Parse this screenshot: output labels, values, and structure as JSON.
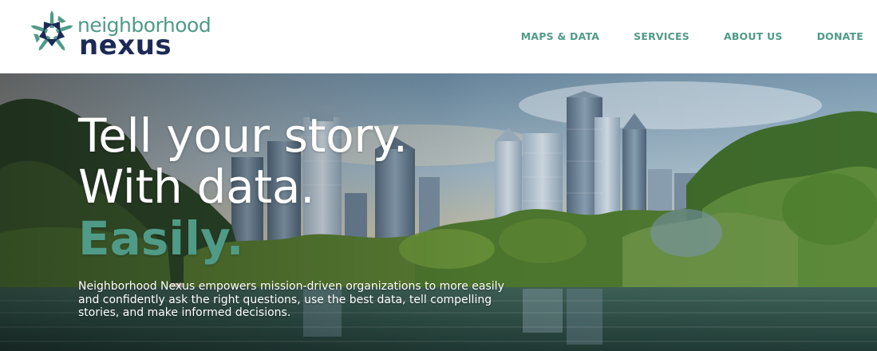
{
  "logo": {
    "line1": "neighborhood",
    "line2": "nexus",
    "icon": "nexus-star-logo"
  },
  "nav": {
    "items": [
      {
        "label": "MAPS & DATA"
      },
      {
        "label": "SERVICES"
      },
      {
        "label": "ABOUT US"
      },
      {
        "label": "DONATE"
      }
    ]
  },
  "hero": {
    "headline_line1": "Tell your story.",
    "headline_line2": "With data.",
    "headline_emphasis": "Easily.",
    "description": "Neighborhood Nexus empowers mission-driven organizations to more easily and confidently ask the right questions, use the best data, tell compelling stories, and make informed decisions.",
    "background": "city-skyline-over-lake-photo"
  },
  "colors": {
    "brand_teal": "#4f9b87",
    "brand_navy": "#1d2a57",
    "header_bg": "#ffffff"
  }
}
